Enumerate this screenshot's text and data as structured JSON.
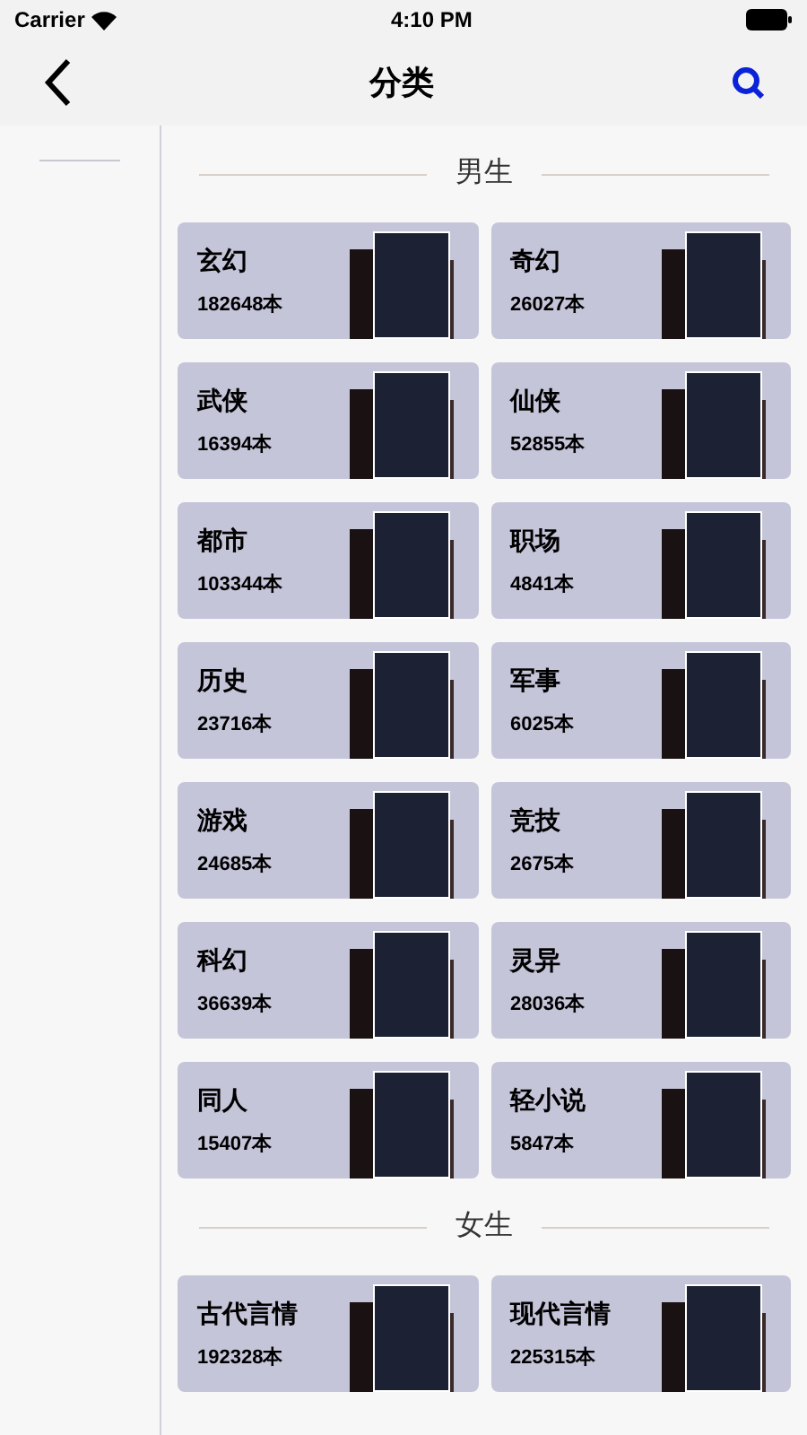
{
  "status_bar": {
    "carrier": "Carrier",
    "time": "4:10 PM"
  },
  "nav": {
    "title": "分类"
  },
  "sections": [
    {
      "title": "男生",
      "categories": [
        {
          "name": "玄幻",
          "count": "182648本"
        },
        {
          "name": "奇幻",
          "count": "26027本"
        },
        {
          "name": "武侠",
          "count": "16394本"
        },
        {
          "name": "仙侠",
          "count": "52855本"
        },
        {
          "name": "都市",
          "count": "103344本"
        },
        {
          "name": "职场",
          "count": "4841本"
        },
        {
          "name": "历史",
          "count": "23716本"
        },
        {
          "name": "军事",
          "count": "6025本"
        },
        {
          "name": "游戏",
          "count": "24685本"
        },
        {
          "name": "竞技",
          "count": "2675本"
        },
        {
          "name": "科幻",
          "count": "36639本"
        },
        {
          "name": "灵异",
          "count": "28036本"
        },
        {
          "name": "同人",
          "count": "15407本"
        },
        {
          "name": "轻小说",
          "count": "5847本"
        }
      ]
    },
    {
      "title": "女生",
      "categories": [
        {
          "name": "古代言情",
          "count": "192328本"
        },
        {
          "name": "现代言情",
          "count": "225315本"
        }
      ]
    }
  ]
}
